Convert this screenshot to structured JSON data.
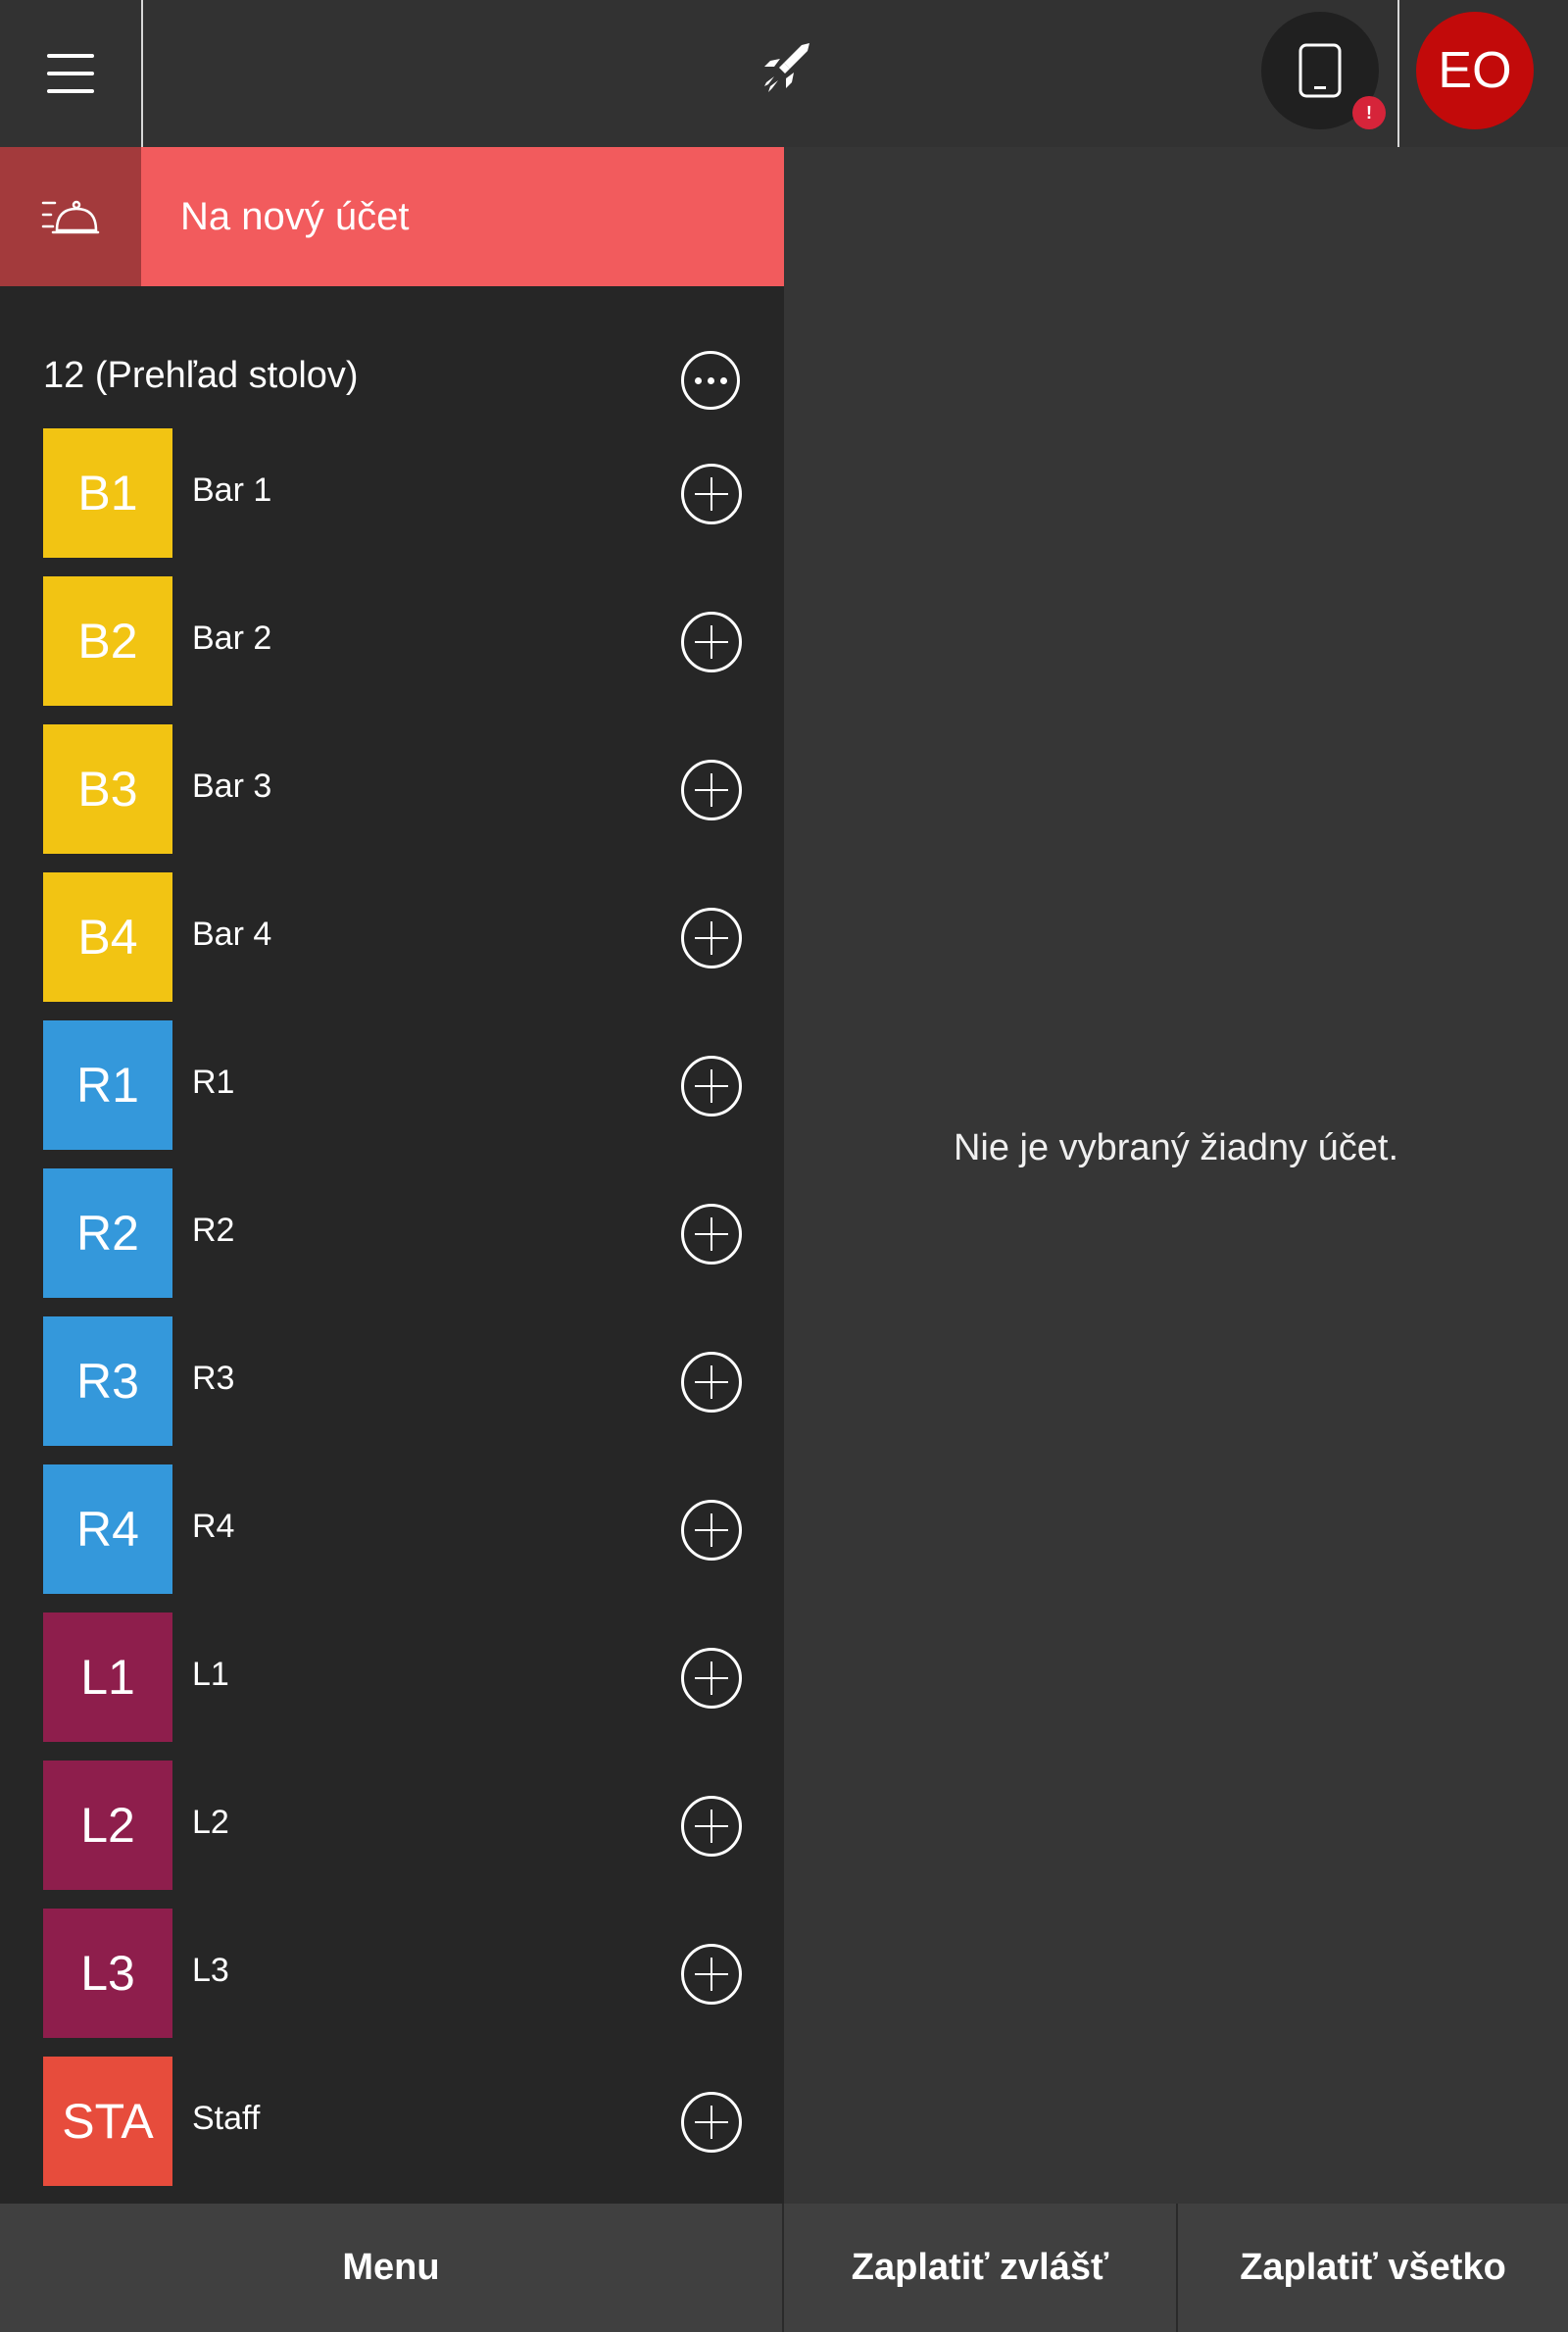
{
  "header": {
    "menu_icon": "hamburger-icon",
    "rocket_icon": "rocket-icon",
    "device_icon": "tablet-icon",
    "device_badge": "!",
    "avatar_initials": "EO",
    "avatar_color": "#c20a0a"
  },
  "new_account": {
    "icon": "serving-bell-icon",
    "label": "Na nový účet",
    "accent": "#f25b5d"
  },
  "tables_section": {
    "title": "12 (Prehľad stolov)",
    "more_icon": "more-horizontal-icon",
    "items": [
      {
        "code": "B1",
        "name": "Bar 1",
        "color": "#f2c413"
      },
      {
        "code": "B2",
        "name": "Bar 2",
        "color": "#f2c413"
      },
      {
        "code": "B3",
        "name": "Bar 3",
        "color": "#f2c413"
      },
      {
        "code": "B4",
        "name": "Bar 4",
        "color": "#f2c413"
      },
      {
        "code": "R1",
        "name": "R1",
        "color": "#3498db"
      },
      {
        "code": "R2",
        "name": "R2",
        "color": "#3498db"
      },
      {
        "code": "R3",
        "name": "R3",
        "color": "#3498db"
      },
      {
        "code": "R4",
        "name": "R4",
        "color": "#3498db"
      },
      {
        "code": "L1",
        "name": "L1",
        "color": "#8e1e4c"
      },
      {
        "code": "L2",
        "name": "L2",
        "color": "#8e1e4c"
      },
      {
        "code": "L3",
        "name": "L3",
        "color": "#8e1e4c"
      },
      {
        "code": "STA",
        "name": "Staff",
        "color": "#e74c3c"
      }
    ]
  },
  "detail": {
    "empty_message": "Nie je vybraný žiadny účet."
  },
  "footer": {
    "menu_label": "Menu",
    "pay_separately_label": "Zaplatiť zvlášť",
    "pay_all_label": "Zaplatiť všetko"
  }
}
